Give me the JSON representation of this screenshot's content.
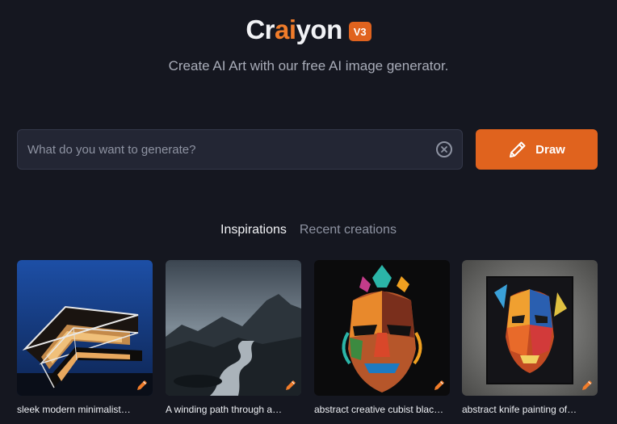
{
  "header": {
    "logo_prefix": "Cr",
    "logo_accent": "ai",
    "logo_suffix": "yon",
    "version": "V3",
    "tagline": "Create AI Art with our free AI image generator."
  },
  "search": {
    "placeholder": "What do you want to generate?",
    "value": "",
    "clear_icon": "close-circle-icon"
  },
  "draw_button": {
    "label": "Draw",
    "icon": "pencil-icon"
  },
  "tabs": [
    {
      "label": "Inspirations",
      "active": true
    },
    {
      "label": "Recent creations",
      "active": false
    }
  ],
  "inspirations": [
    {
      "caption": "sleek modern minimalist…",
      "icon": "edit-pencil-icon"
    },
    {
      "caption": "A winding path through a…",
      "icon": "edit-pencil-icon"
    },
    {
      "caption": "abstract creative cubist blac…",
      "icon": "edit-pencil-icon"
    },
    {
      "caption": "abstract knife painting of…",
      "icon": "edit-pencil-icon"
    }
  ],
  "colors": {
    "background": "#151720",
    "accent": "#e0631e",
    "logo_accent": "#f07c2a",
    "input_bg": "#232634"
  }
}
